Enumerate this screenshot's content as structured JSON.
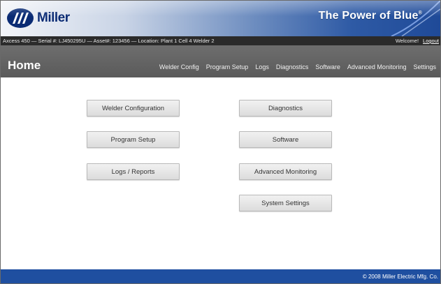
{
  "header": {
    "logo_text": "Miller",
    "tagline": "The Power of Blue",
    "tagline_mark": "®"
  },
  "infobar": {
    "device_info": "Axcess 450 — Serial #: LJ450295U — Asset#: 123456 — Location: Plant 1 Cell 4 Welder 2",
    "welcome": "Welcome!",
    "logout": "Logout"
  },
  "navbar": {
    "page_title": "Home",
    "items": [
      "Welder Config",
      "Program Setup",
      "Logs",
      "Diagnostics",
      "Software",
      "Advanced Monitoring",
      "Settings"
    ]
  },
  "buttons": {
    "left": [
      "Welder Configuration",
      "Program Setup",
      "Logs / Reports"
    ],
    "right": [
      "Diagnostics",
      "Software",
      "Advanced Monitoring",
      "System Settings"
    ]
  },
  "footer": {
    "copyright": "© 2008 Miller Electric Mfg. Co."
  },
  "colors": {
    "brand_blue": "#1f4fa0",
    "logo_navy": "#0a2b74",
    "nav_gray": "#606060",
    "info_bar": "#2b2b2b"
  }
}
